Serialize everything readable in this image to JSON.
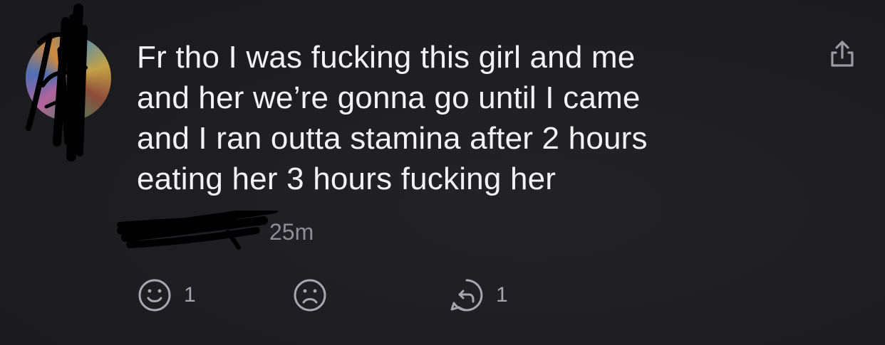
{
  "post": {
    "lines": [
      "Fr tho I was fucking this girl and me",
      "and her we’re gonna go until I came",
      "and I ran outta stamina after 2 hours",
      "eating her 3 hours fucking her"
    ],
    "timestamp": "25m"
  },
  "actions": {
    "upvote_count": "1",
    "reply_count": "1"
  },
  "icons": {
    "share": "share-icon",
    "upvote": "smile-icon",
    "downvote": "frown-icon",
    "reply": "reply-icon"
  },
  "colors": {
    "background": "#1e1e22",
    "text": "#f2f2f4",
    "muted": "#8d8d93"
  }
}
